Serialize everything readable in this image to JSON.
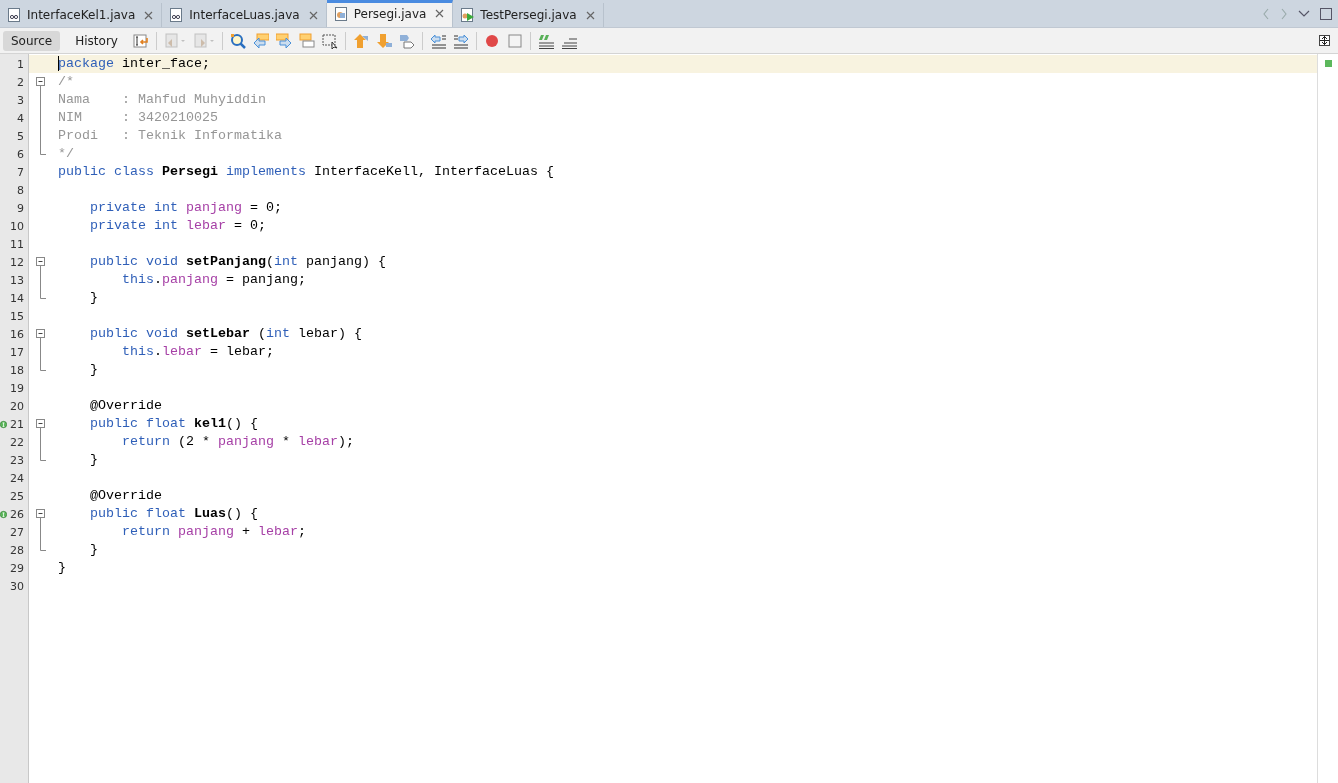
{
  "tabs": [
    {
      "label": "InterfaceKel1.java",
      "kind": "interface",
      "selected": false
    },
    {
      "label": "InterfaceLuas.java",
      "kind": "interface",
      "selected": false
    },
    {
      "label": "Persegi.java",
      "kind": "class",
      "selected": true
    },
    {
      "label": "TestPersegi.java",
      "kind": "test",
      "selected": false
    }
  ],
  "toolbar": {
    "views": [
      {
        "label": "Source",
        "selected": true
      },
      {
        "label": "History",
        "selected": false
      }
    ],
    "tools": [
      {
        "kind": "last-edit",
        "disabled": false
      },
      {
        "kind": "separator"
      },
      {
        "kind": "prev-bookmark",
        "disabled": true
      },
      {
        "kind": "next-bookmark",
        "disabled": true
      },
      {
        "kind": "separator"
      },
      {
        "kind": "find",
        "disabled": false
      },
      {
        "kind": "find-prev",
        "disabled": false
      },
      {
        "kind": "find-next",
        "disabled": false
      },
      {
        "kind": "highlight",
        "disabled": false
      },
      {
        "kind": "rect-select",
        "disabled": false
      },
      {
        "kind": "separator"
      },
      {
        "kind": "move-up",
        "disabled": false
      },
      {
        "kind": "move-down",
        "disabled": false
      },
      {
        "kind": "shape",
        "disabled": false
      },
      {
        "kind": "separator"
      },
      {
        "kind": "shift-left",
        "disabled": false
      },
      {
        "kind": "shift-right",
        "disabled": false
      },
      {
        "kind": "separator"
      },
      {
        "kind": "record",
        "disabled": false
      },
      {
        "kind": "stop",
        "disabled": false
      },
      {
        "kind": "separator"
      },
      {
        "kind": "comment",
        "disabled": false
      },
      {
        "kind": "uncomment",
        "disabled": false
      }
    ]
  },
  "editor": {
    "lines": [
      {
        "number": "1",
        "kind": "plain",
        "current": true,
        "tokens": [
          {
            "kind": "kw",
            "text": "package"
          },
          {
            "kind": "plain",
            "text": " inter_face;"
          }
        ]
      },
      {
        "number": "2",
        "kind": "fold-start",
        "expanded": true,
        "tokens": [
          {
            "kind": "comment",
            "text": "/*"
          }
        ]
      },
      {
        "number": "3",
        "kind": "fold-body",
        "tokens": [
          {
            "kind": "comment",
            "text": "Nama    : Mahfud Muhyiddin"
          }
        ]
      },
      {
        "number": "4",
        "kind": "fold-body",
        "tokens": [
          {
            "kind": "comment",
            "text": "NIM     : 3420210025"
          }
        ]
      },
      {
        "number": "5",
        "kind": "fold-body",
        "tokens": [
          {
            "kind": "comment",
            "text": "Prodi   : Teknik Informatika"
          }
        ]
      },
      {
        "number": "6",
        "kind": "fold-end",
        "tokens": [
          {
            "kind": "comment",
            "text": "*/"
          }
        ]
      },
      {
        "number": "7",
        "kind": "plain",
        "tokens": [
          {
            "kind": "kw",
            "text": "public class "
          },
          {
            "kind": "bold",
            "text": "Persegi "
          },
          {
            "kind": "kw",
            "text": "implements "
          },
          {
            "kind": "plain",
            "text": "InterfaceKell, InterfaceLuas {"
          }
        ]
      },
      {
        "number": "8",
        "kind": "plain"
      },
      {
        "number": "9",
        "kind": "plain",
        "tokens": [
          {
            "kind": "kw",
            "text": "    private int "
          },
          {
            "kind": "field",
            "text": "panjang"
          },
          {
            "kind": "plain",
            "text": " = 0;"
          }
        ]
      },
      {
        "number": "10",
        "kind": "plain",
        "tokens": [
          {
            "kind": "kw",
            "text": "    private int "
          },
          {
            "kind": "field",
            "text": "lebar"
          },
          {
            "kind": "plain",
            "text": " = 0;"
          }
        ]
      },
      {
        "number": "11",
        "kind": "plain"
      },
      {
        "number": "12",
        "kind": "fold-start",
        "expanded": true,
        "tokens": [
          {
            "kind": "kw",
            "text": "    public void "
          },
          {
            "kind": "bold",
            "text": "setPanjang"
          },
          {
            "kind": "plain",
            "text": "("
          },
          {
            "kind": "kw",
            "text": "int "
          },
          {
            "kind": "plain",
            "text": "panjang) {"
          }
        ]
      },
      {
        "number": "13",
        "kind": "fold-body",
        "tokens": [
          {
            "kind": "kw",
            "text": "        this"
          },
          {
            "kind": "plain",
            "text": "."
          },
          {
            "kind": "field",
            "text": "panjang"
          },
          {
            "kind": "plain",
            "text": " = panjang;"
          }
        ]
      },
      {
        "number": "14",
        "kind": "fold-end",
        "tokens": [
          {
            "kind": "plain",
            "text": "    }"
          }
        ]
      },
      {
        "number": "15",
        "kind": "plain"
      },
      {
        "number": "16",
        "kind": "fold-start",
        "expanded": true,
        "tokens": [
          {
            "kind": "kw",
            "text": "    public void "
          },
          {
            "kind": "bold",
            "text": "setLebar"
          },
          {
            "kind": "plain",
            "text": " ("
          },
          {
            "kind": "kw",
            "text": "int "
          },
          {
            "kind": "plain",
            "text": "lebar) {"
          }
        ]
      },
      {
        "number": "17",
        "kind": "fold-body",
        "tokens": [
          {
            "kind": "kw",
            "text": "        this"
          },
          {
            "kind": "plain",
            "text": "."
          },
          {
            "kind": "field",
            "text": "lebar"
          },
          {
            "kind": "plain",
            "text": " = lebar;"
          }
        ]
      },
      {
        "number": "18",
        "kind": "fold-end",
        "tokens": [
          {
            "kind": "plain",
            "text": "    }"
          }
        ]
      },
      {
        "number": "19",
        "kind": "plain"
      },
      {
        "number": "20",
        "kind": "plain",
        "tokens": [
          {
            "kind": "plain",
            "text": "    @Override"
          }
        ]
      },
      {
        "number": "21",
        "kind": "fold-start",
        "expanded": true,
        "implements_mark": true,
        "tokens": [
          {
            "kind": "kw",
            "text": "    public float "
          },
          {
            "kind": "bold",
            "text": "kel1"
          },
          {
            "kind": "plain",
            "text": "() {"
          }
        ]
      },
      {
        "number": "22",
        "kind": "fold-body",
        "tokens": [
          {
            "kind": "kw",
            "text": "        return"
          },
          {
            "kind": "plain",
            "text": " (2 * "
          },
          {
            "kind": "field",
            "text": "panjang"
          },
          {
            "kind": "plain",
            "text": " * "
          },
          {
            "kind": "field",
            "text": "lebar"
          },
          {
            "kind": "plain",
            "text": ");"
          }
        ]
      },
      {
        "number": "23",
        "kind": "fold-end",
        "tokens": [
          {
            "kind": "plain",
            "text": "    }"
          }
        ]
      },
      {
        "number": "24",
        "kind": "plain"
      },
      {
        "number": "25",
        "kind": "plain",
        "tokens": [
          {
            "kind": "plain",
            "text": "    @Override"
          }
        ]
      },
      {
        "number": "26",
        "kind": "fold-start",
        "expanded": true,
        "implements_mark": true,
        "tokens": [
          {
            "kind": "kw",
            "text": "    public float "
          },
          {
            "kind": "bold",
            "text": "Luas"
          },
          {
            "kind": "plain",
            "text": "() {"
          }
        ]
      },
      {
        "number": "27",
        "kind": "fold-body",
        "tokens": [
          {
            "kind": "kw",
            "text": "        return "
          },
          {
            "kind": "field",
            "text": "panjang"
          },
          {
            "kind": "plain",
            "text": " + "
          },
          {
            "kind": "field",
            "text": "lebar"
          },
          {
            "kind": "plain",
            "text": ";"
          }
        ]
      },
      {
        "number": "28",
        "kind": "fold-end",
        "tokens": [
          {
            "kind": "plain",
            "text": "    }"
          }
        ]
      },
      {
        "number": "29",
        "kind": "plain",
        "tokens": [
          {
            "kind": "plain",
            "text": "}"
          }
        ]
      },
      {
        "number": "30",
        "kind": "plain"
      }
    ]
  }
}
